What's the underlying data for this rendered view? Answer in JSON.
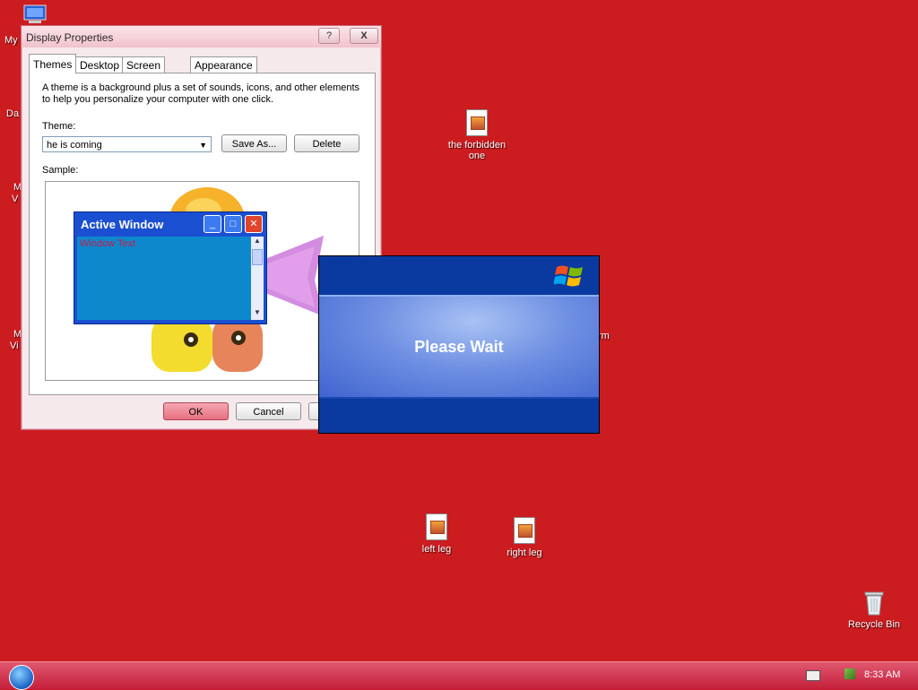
{
  "desktop": {
    "background_color": "#cb1c20",
    "left_clipped_labels": [
      "My",
      "Da",
      "M",
      "V",
      "M",
      "Vi"
    ],
    "partial_label_right": "rm",
    "icons": [
      {
        "label": "the forbidden one",
        "icon": "document-image-icon"
      },
      {
        "label": "left leg",
        "icon": "document-image-icon"
      },
      {
        "label": "right leg",
        "icon": "document-image-icon"
      },
      {
        "label": "Recycle Bin",
        "icon": "recycle-bin-icon"
      }
    ]
  },
  "dialog": {
    "title": "Display Properties",
    "help_label": "?",
    "close_label": "X",
    "tabs": [
      {
        "label": "Themes",
        "active": true
      },
      {
        "label": "Desktop",
        "active": false
      },
      {
        "label": "Screen Saver",
        "active": false
      },
      {
        "label": "Appearance",
        "active": false
      }
    ],
    "description": "A theme is a background plus a set of sounds, icons, and other elements to help you personalize your computer with one click.",
    "theme_label": "Theme:",
    "theme_value": "he is coming",
    "save_as_label": "Save As...",
    "delete_label": "Delete",
    "sample_label": "Sample:",
    "ok_label": "OK",
    "cancel_label": "Cancel",
    "sample": {
      "active_window_title": "Active Window",
      "window_text": "Window Text"
    }
  },
  "please_wait": {
    "text": "Please Wait"
  },
  "taskbar": {
    "clock": "8:33 AM"
  },
  "colors": {
    "taskbar": "#d23a52",
    "please_wait_bar": "#0a3aa0"
  }
}
